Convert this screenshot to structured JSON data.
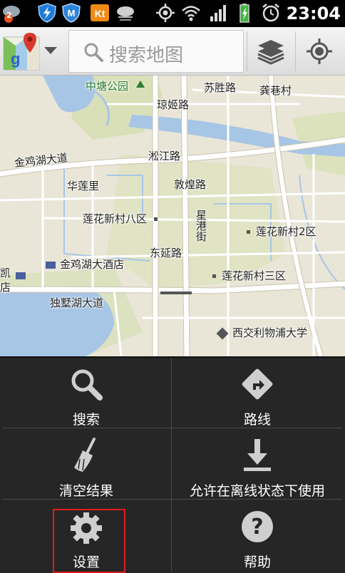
{
  "status_bar": {
    "notification_count": "2",
    "icons": [
      "cloud-notification-icon",
      "shield-app-icon",
      "m-app-icon",
      "kt-app-icon",
      "weather-app-icon",
      "gps-icon",
      "wifi-icon",
      "signal-icon",
      "battery-charging-icon",
      "alarm-icon"
    ],
    "time": "23:04"
  },
  "toolbar": {
    "logo_icon": "google-maps-logo-icon",
    "search_placeholder": "搜索地图",
    "layers_icon": "layers-icon",
    "my_location_icon": "my-location-icon"
  },
  "map": {
    "labels": {
      "park": "中塘公园",
      "suzhou_shenglu": "苏胜路",
      "gongcun": "龚巷村",
      "qiongji": "琼姬路",
      "jinjihu_dadao": "金鸡湖大道",
      "songjiang": "淞江路",
      "hualian": "华莲里",
      "dunhuang": "敦煌路",
      "lianhua8": "莲花新村八区",
      "xinggang": "星港街",
      "lianhua2": "莲花新村2区",
      "dongyan": "东延路",
      "hotel": "金鸡湖大酒店",
      "lianhua3": "莲花新村三区",
      "partial_kai": "凯",
      "partial_dian": "店",
      "dushu": "独墅湖大道",
      "xijiao": "西交利物浦大学"
    },
    "colors": {
      "land": "#e9e6d7",
      "water": "#a7c6e6",
      "green": "#cddca3",
      "road": "#ffffff",
      "road_edge": "#c8c4b0"
    }
  },
  "menu": {
    "items": [
      {
        "label": "搜索",
        "icon": "search-icon"
      },
      {
        "label": "路线",
        "icon": "directions-icon"
      },
      {
        "label": "清空结果",
        "icon": "broom-icon"
      },
      {
        "label": "允许在离线状态下使用",
        "icon": "download-icon"
      },
      {
        "label": "设置",
        "icon": "gear-icon"
      },
      {
        "label": "帮助",
        "icon": "help-icon"
      }
    ],
    "highlight_color": "#e01b1b"
  }
}
